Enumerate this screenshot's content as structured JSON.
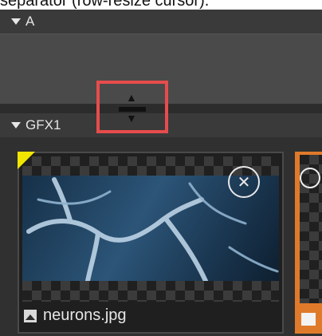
{
  "caption": {
    "text": "separator (row-resize cursor)."
  },
  "sections": {
    "a": {
      "title": "A"
    },
    "gfx": {
      "title": "GFX1"
    }
  },
  "tiles": [
    {
      "filename": "neurons.jpg",
      "remove_icon": "close-icon",
      "type_icon": "image-icon",
      "corner_color": "#f2e600"
    },
    {
      "type_icon": "film-icon",
      "border_color": "#e07a2b"
    }
  ],
  "cursor": {
    "icon": "row-resize-icon",
    "highlight_color": "#e74c4c"
  }
}
